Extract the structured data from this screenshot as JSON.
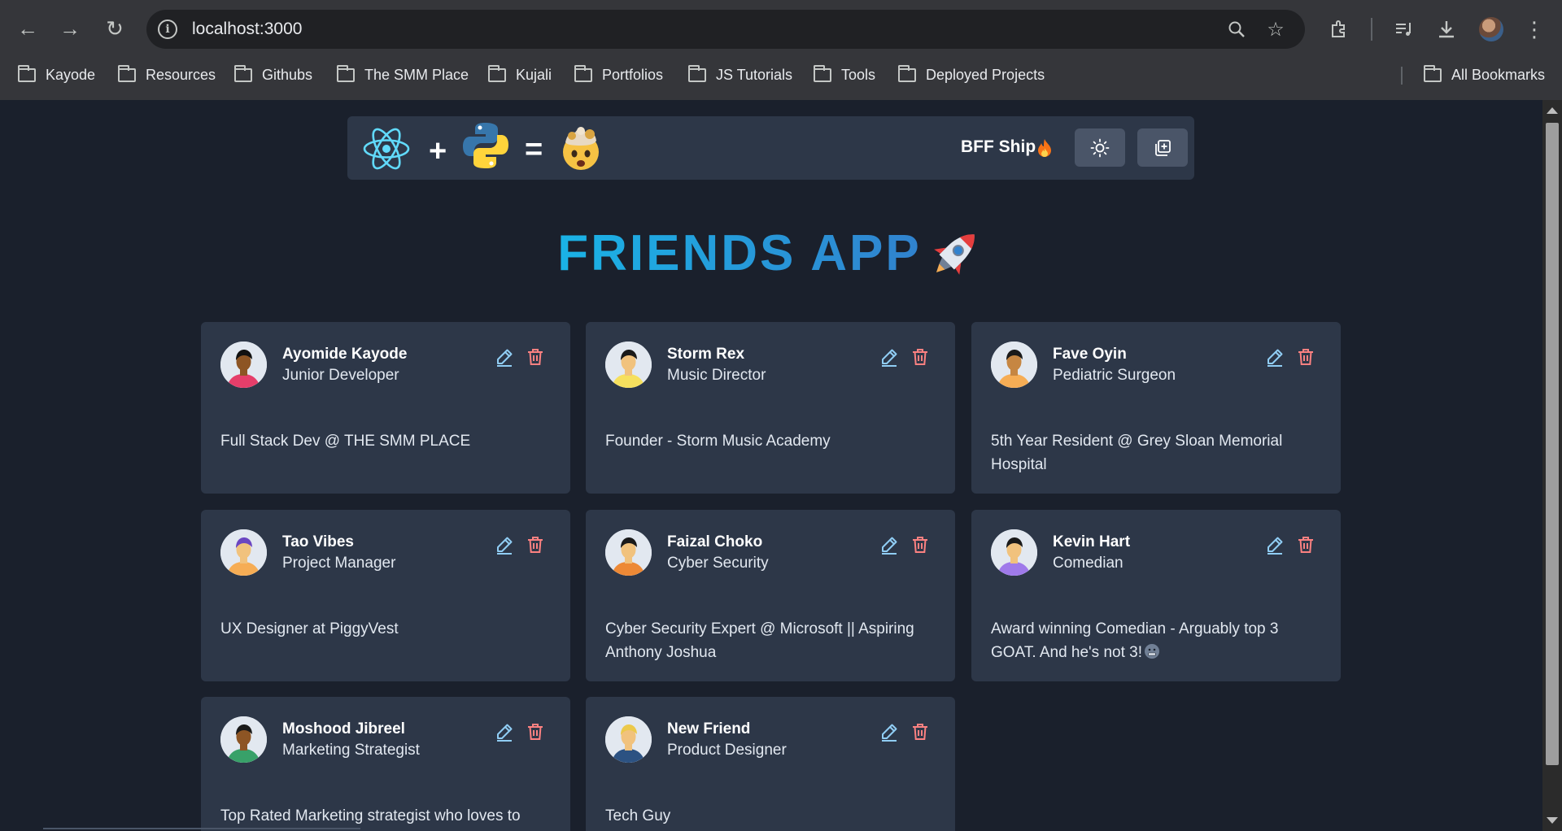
{
  "browser": {
    "url": "localhost:3000",
    "bookmarks": [
      "Kayode",
      "Resources",
      "Githubs",
      "The SMM Place",
      "Kujali",
      "Portfolios",
      "JS Tutorials",
      "Tools",
      "Deployed Projects"
    ],
    "all_bookmarks": "All Bookmarks"
  },
  "navbar": {
    "plus": "+",
    "equals": "=",
    "brand": "BFF Ship",
    "theme_icon": "sun-icon",
    "add_icon": "add-square-icon"
  },
  "app": {
    "title": "FRIENDS APP"
  },
  "friends": [
    {
      "name": "Ayomide Kayode",
      "role": "Junior Developer",
      "description": "Full Stack Dev @ THE SMM PLACE",
      "avatar": {
        "skin": "#8d5524",
        "hair": "#111111",
        "shirt": "#e53e6a"
      }
    },
    {
      "name": "Storm Rex",
      "role": "Music Director",
      "description": "Founder - Storm Music Academy",
      "avatar": {
        "skin": "#f1c27d",
        "hair": "#1a1a1a",
        "shirt": "#f6e05e"
      }
    },
    {
      "name": "Fave Oyin",
      "role": "Pediatric Surgeon",
      "description": "5th Year Resident @ Grey Sloan Memorial Hospital",
      "avatar": {
        "skin": "#c68642",
        "hair": "#1a1a1a",
        "shirt": "#f6ad55"
      }
    },
    {
      "name": "Tao Vibes",
      "role": "Project Manager",
      "description": "UX Designer at PiggyVest",
      "avatar": {
        "skin": "#f1c27d",
        "hair": "#6b46c1",
        "shirt": "#f6ad55"
      }
    },
    {
      "name": "Faizal Choko",
      "role": "Cyber Security",
      "description": "Cyber Security Expert @ Microsoft || Aspiring Anthony Joshua",
      "avatar": {
        "skin": "#f1c27d",
        "hair": "#1a1a1a",
        "shirt": "#ed8936"
      }
    },
    {
      "name": "Kevin Hart",
      "role": "Comedian",
      "description": "Award winning Comedian - Arguably top 3 GOAT. And he's not 3!",
      "avatar": {
        "skin": "#f1c27d",
        "hair": "#1a1a1a",
        "shirt": "#9f7aea"
      }
    },
    {
      "name": "Moshood Jibreel",
      "role": "Marketing Strategist",
      "description": "Top Rated Marketing strategist who loves to",
      "avatar": {
        "skin": "#8d5524",
        "hair": "#1a1a1a",
        "shirt": "#38a169"
      }
    },
    {
      "name": "New Friend",
      "role": "Product Designer",
      "description": "Tech Guy",
      "avatar": {
        "skin": "#f1c27d",
        "hair": "#ecc94b",
        "shirt": "#2c5282"
      }
    }
  ]
}
